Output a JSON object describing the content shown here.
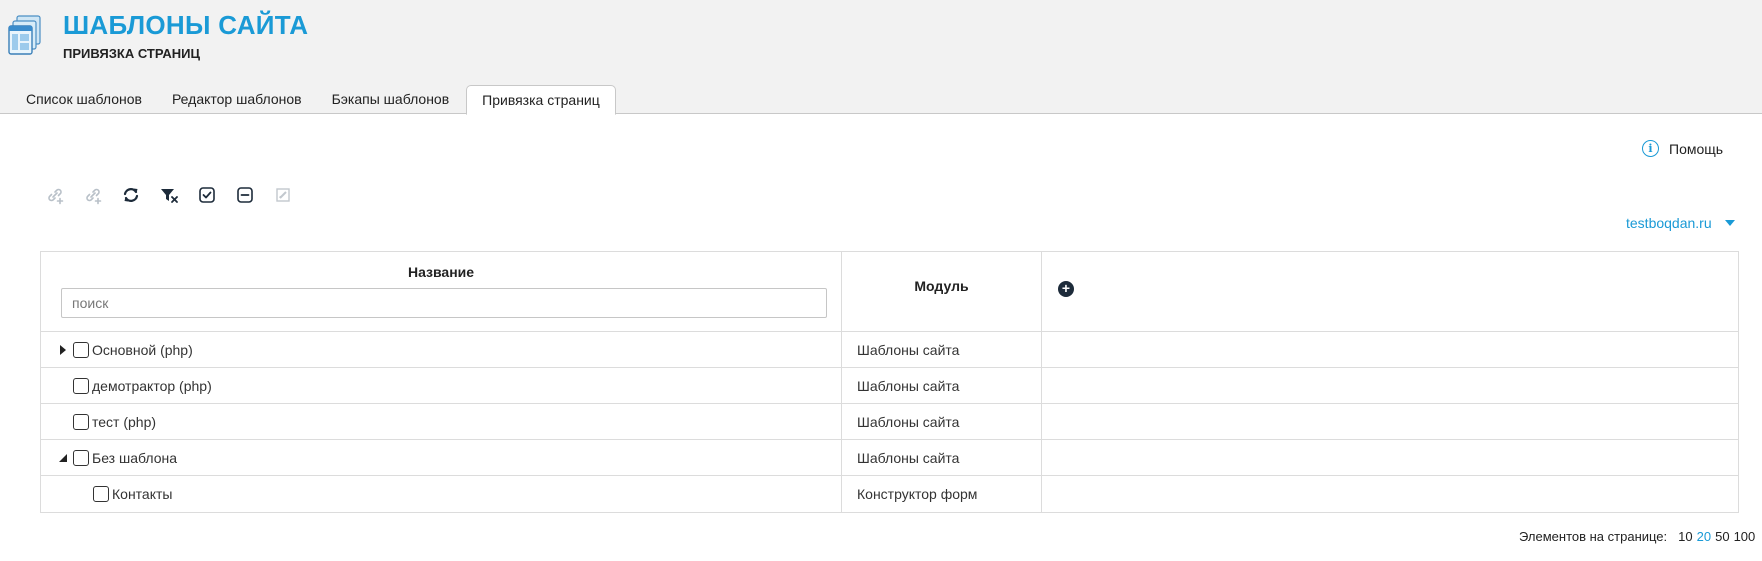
{
  "header": {
    "title": "ШАБЛОНЫ САЙТА",
    "subtitle": "ПРИВЯЗКА СТРАНИЦ",
    "logo_icon": "templates-window-icon"
  },
  "tabs": [
    {
      "label": "Список шаблонов",
      "active": false
    },
    {
      "label": "Редактор шаблонов",
      "active": false
    },
    {
      "label": "Бэкапы шаблонов",
      "active": false
    },
    {
      "label": "Привязка страниц",
      "active": true
    }
  ],
  "help": {
    "label": "Помощь",
    "icon": "info-icon"
  },
  "toolbar": {
    "buttons": [
      {
        "icon": "link-add-icon",
        "enabled": false
      },
      {
        "icon": "link-add-alt-icon",
        "enabled": false
      },
      {
        "icon": "refresh-icon",
        "enabled": true
      },
      {
        "icon": "clear-filter-icon",
        "enabled": true
      },
      {
        "icon": "check-all-icon",
        "enabled": true
      },
      {
        "icon": "uncheck-all-icon",
        "enabled": true
      },
      {
        "icon": "edit-icon",
        "enabled": false
      }
    ]
  },
  "site_selector": {
    "value": "testboqdan.ru",
    "icon": "caret-down-icon"
  },
  "grid": {
    "columns": {
      "name": "Название",
      "module": "Модуль"
    },
    "search_placeholder": "поиск",
    "add_column_icon": "plus-circle-icon",
    "rows": [
      {
        "name": "Основной (php)",
        "module": "Шаблоны сайта",
        "level": 0,
        "toggle": "collapsed"
      },
      {
        "name": "демотрактор (php)",
        "module": "Шаблоны сайта",
        "level": 0,
        "toggle": "none"
      },
      {
        "name": "тест (php)",
        "module": "Шаблоны сайта",
        "level": 0,
        "toggle": "none"
      },
      {
        "name": "Без шаблона",
        "module": "Шаблоны сайта",
        "level": 0,
        "toggle": "expanded"
      },
      {
        "name": "Контакты",
        "module": "Конструктор форм",
        "level": 1,
        "toggle": "none"
      }
    ]
  },
  "pager": {
    "label": "Элементов на странице:",
    "options": [
      "10",
      "20",
      "50",
      "100"
    ],
    "selected": "20"
  },
  "colors": {
    "accent": "#1a9ad6",
    "header_bg": "#f2f2f2",
    "border": "#dcdcdc",
    "dark_icon": "#1d2b3a"
  }
}
